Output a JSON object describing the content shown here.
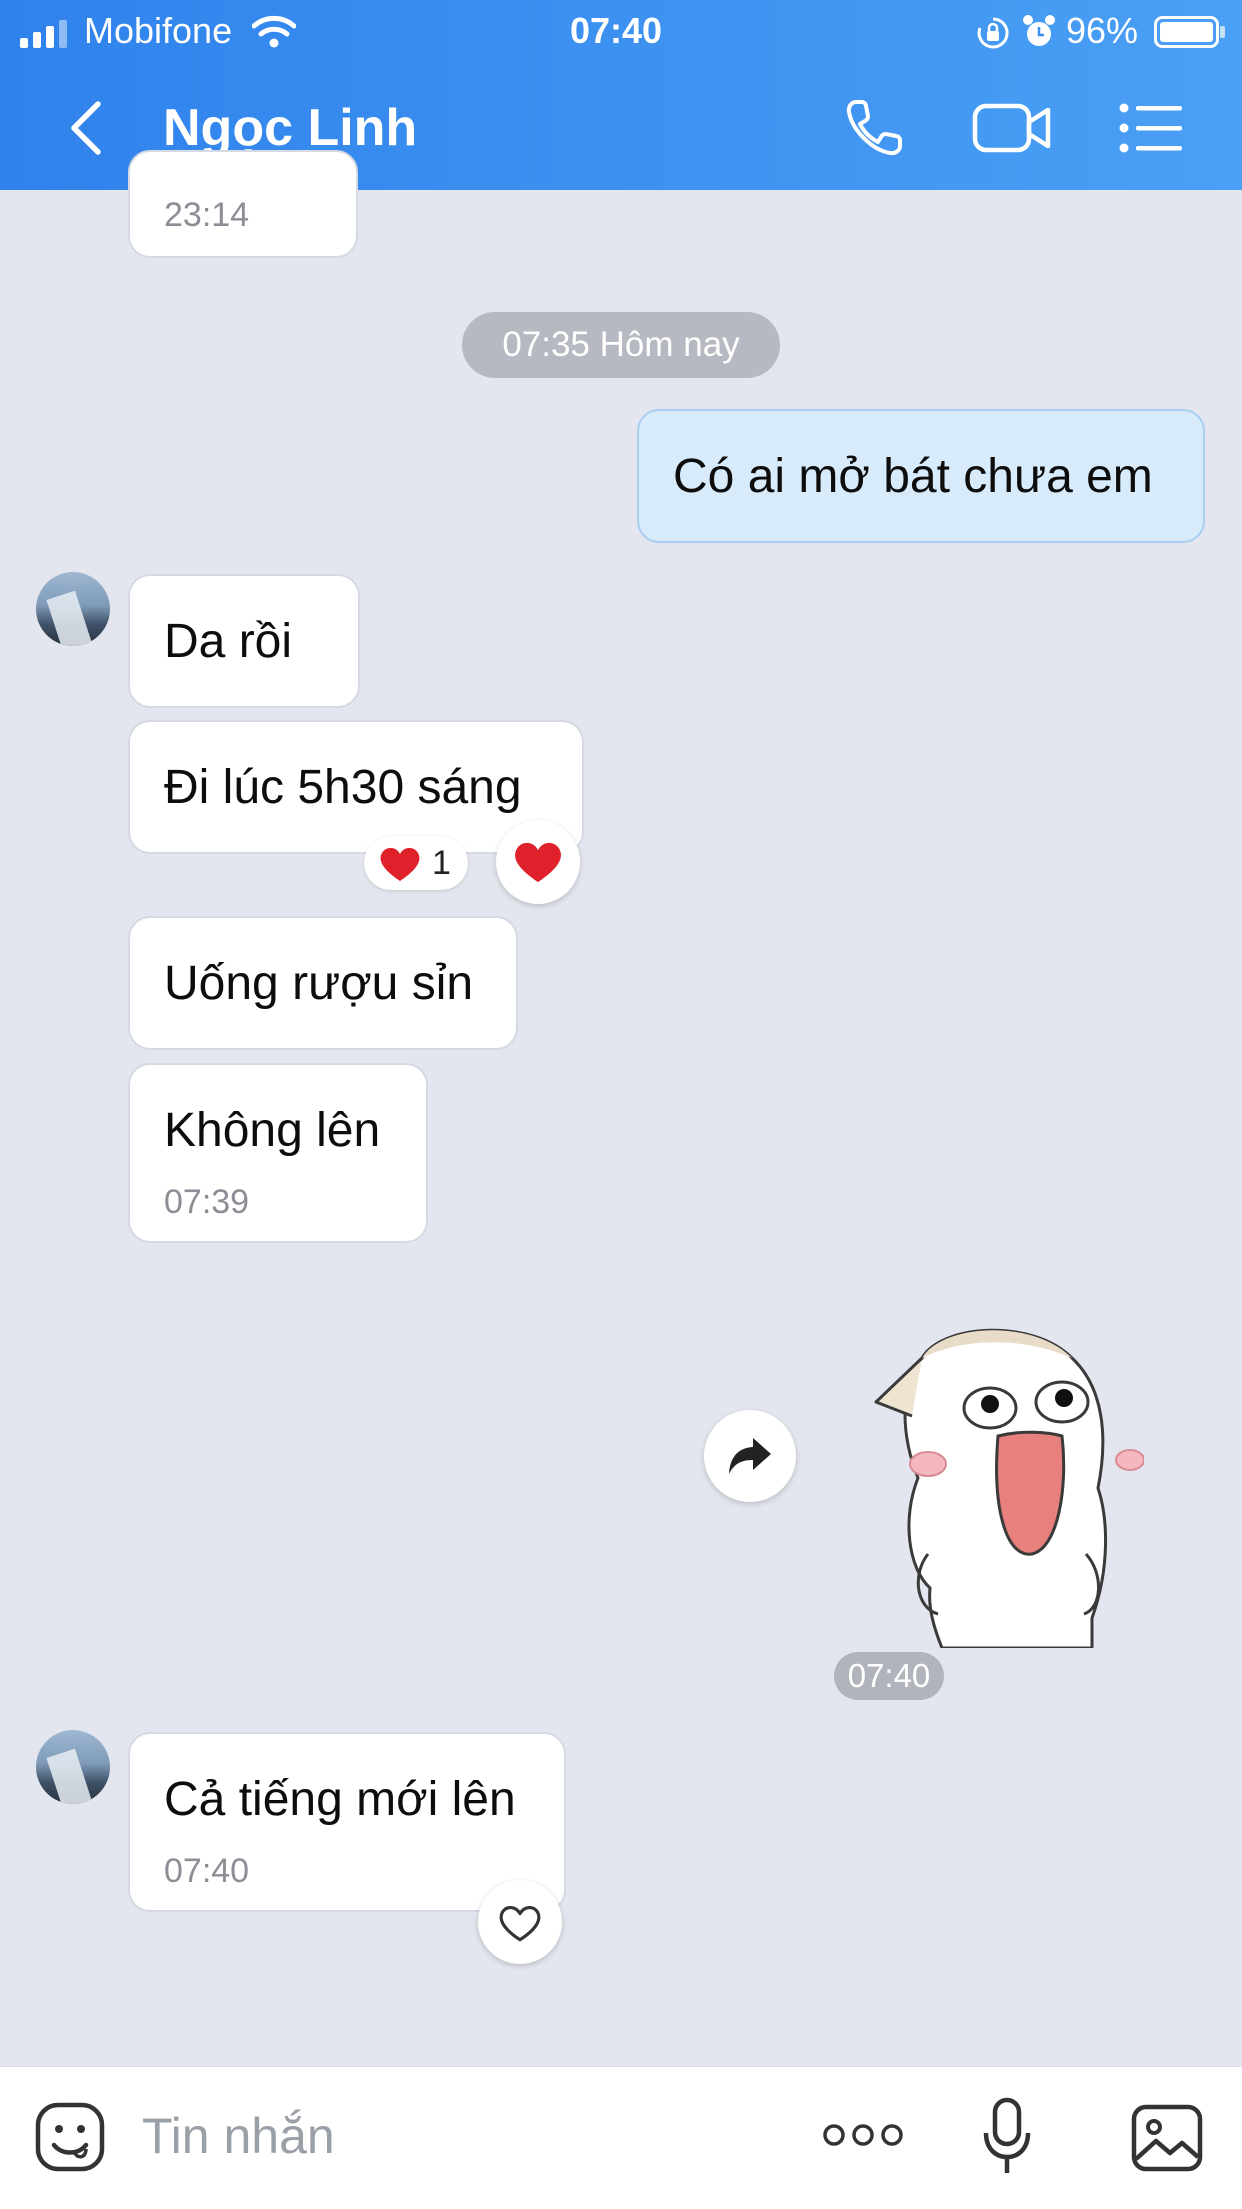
{
  "status_bar": {
    "carrier": "Mobifone",
    "time": "07:40",
    "battery": "96%"
  },
  "header": {
    "title": "Ngọc Linh",
    "icons": [
      "back-icon",
      "phone-icon",
      "video-call-icon",
      "menu-icon"
    ]
  },
  "colors": {
    "header_start": "#2f82ec",
    "header_end": "#4aa0f4",
    "background": "#e3e6ee",
    "my_bubble": "#d7ebfb",
    "heart": "#e0212c"
  },
  "messages": {
    "prev_timestamp": "23:14",
    "date_divider": "07:35 Hôm nay",
    "m1": "Có ai mở bát chưa em",
    "m2": "Da rồi",
    "m3": "Đi lúc 5h30 sáng",
    "m3_reaction_count": "1",
    "m4": "Uống rượu sỉn",
    "m5": "Không lên",
    "m5_time": "07:39",
    "sticker_time": "07:40",
    "m6": "Cả tiếng mới lên",
    "m6_time": "07:40"
  },
  "input_bar": {
    "placeholder": "Tin nhắn",
    "icons": [
      "emoji-icon",
      "more-icon",
      "microphone-icon",
      "image-icon"
    ]
  }
}
